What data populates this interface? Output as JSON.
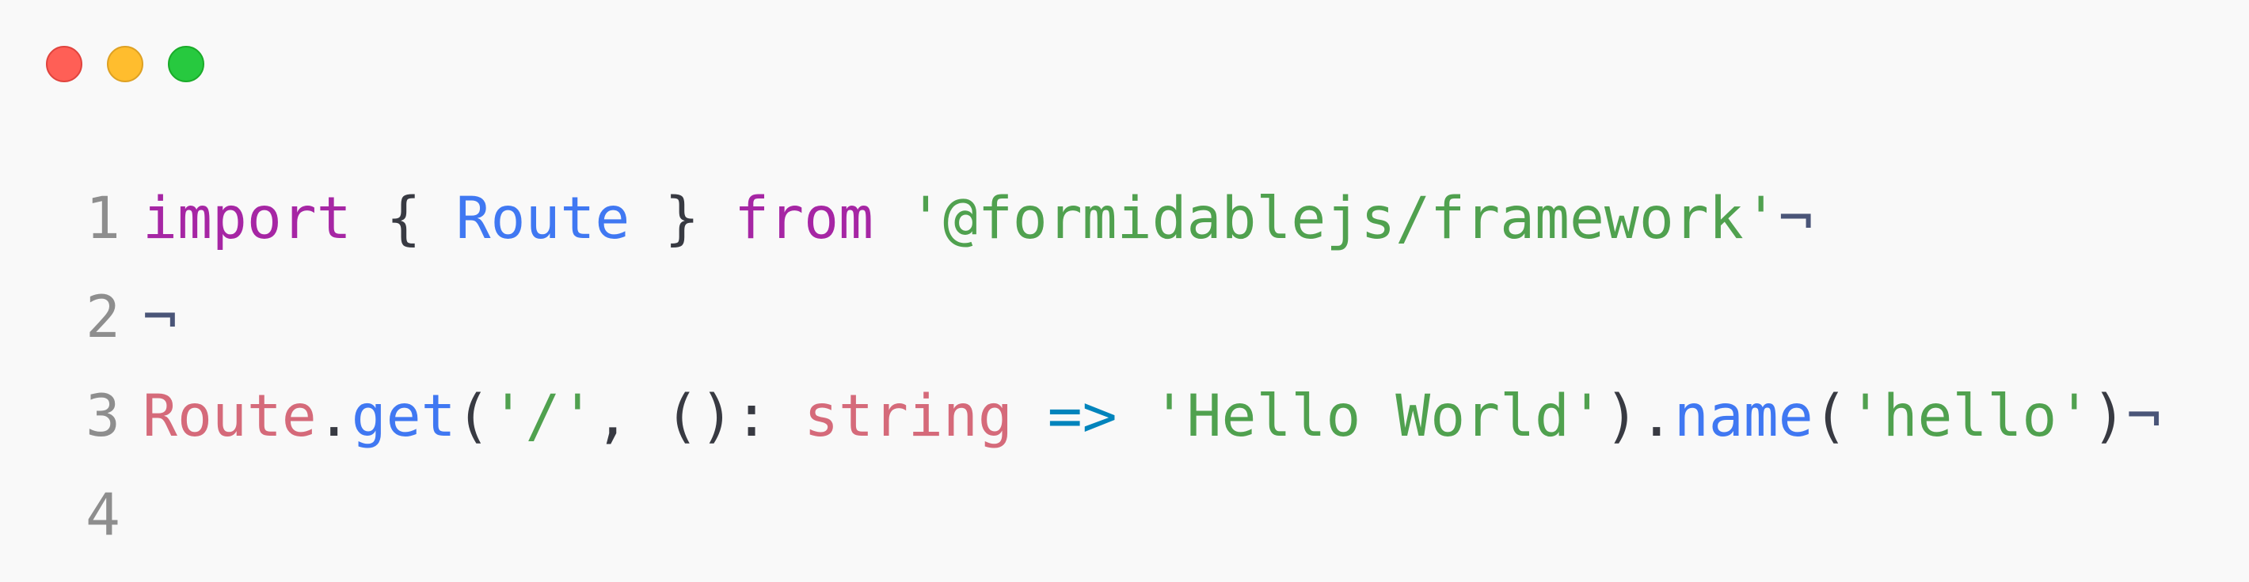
{
  "window": {
    "controls": {
      "close_color": "#ff5f56",
      "minimize_color": "#ffbd2e",
      "maximize_color": "#27c93f"
    }
  },
  "code": {
    "lines": [
      {
        "number": "1",
        "tokens": [
          {
            "text": "import",
            "kind": "keyword"
          },
          {
            "text": " { ",
            "kind": "plain"
          },
          {
            "text": "Route",
            "kind": "class"
          },
          {
            "text": " } ",
            "kind": "plain"
          },
          {
            "text": "from",
            "kind": "keyword"
          },
          {
            "text": " ",
            "kind": "plain"
          },
          {
            "text": "'@formidablejs/framework'",
            "kind": "string"
          },
          {
            "text": "¬",
            "kind": "invis"
          }
        ]
      },
      {
        "number": "2",
        "tokens": [
          {
            "text": "¬",
            "kind": "invis"
          }
        ]
      },
      {
        "number": "3",
        "tokens": [
          {
            "text": "Route",
            "kind": "ident"
          },
          {
            "text": ".",
            "kind": "plain"
          },
          {
            "text": "get",
            "kind": "func"
          },
          {
            "text": "(",
            "kind": "plain"
          },
          {
            "text": "'/'",
            "kind": "string"
          },
          {
            "text": ", (): ",
            "kind": "plain"
          },
          {
            "text": "string",
            "kind": "ident"
          },
          {
            "text": " ",
            "kind": "plain"
          },
          {
            "text": "=>",
            "kind": "arrow"
          },
          {
            "text": " ",
            "kind": "plain"
          },
          {
            "text": "'Hello World'",
            "kind": "string"
          },
          {
            "text": ").",
            "kind": "plain"
          },
          {
            "text": "name",
            "kind": "func"
          },
          {
            "text": "(",
            "kind": "plain"
          },
          {
            "text": "'hello'",
            "kind": "string"
          },
          {
            "text": ")",
            "kind": "plain"
          },
          {
            "text": "¬",
            "kind": "invis"
          }
        ]
      },
      {
        "number": "4",
        "tokens": []
      }
    ]
  }
}
